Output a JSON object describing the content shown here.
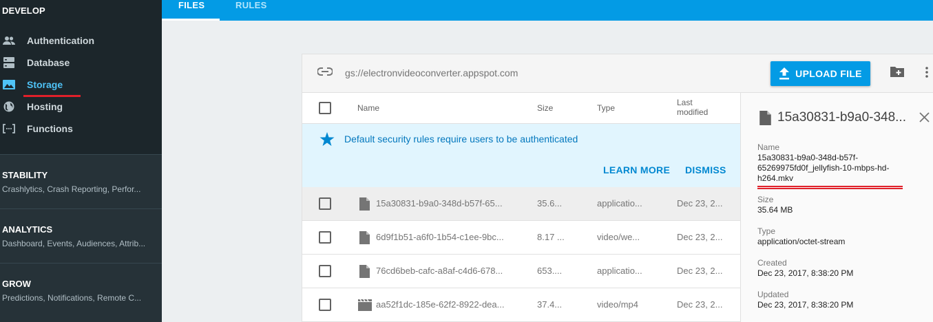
{
  "sidebar": {
    "develop_title": "DEVELOP",
    "items": [
      {
        "label": "Authentication",
        "icon": "people-icon"
      },
      {
        "label": "Database",
        "icon": "database-icon"
      },
      {
        "label": "Storage",
        "icon": "photo-icon"
      },
      {
        "label": "Hosting",
        "icon": "globe-icon"
      },
      {
        "label": "Functions",
        "icon": "functions-icon"
      }
    ],
    "groups": [
      {
        "title": "STABILITY",
        "subtitle": "Crashlytics, Crash Reporting, Perfor..."
      },
      {
        "title": "ANALYTICS",
        "subtitle": "Dashboard, Events, Audiences, Attrib..."
      },
      {
        "title": "GROW",
        "subtitle": "Predictions, Notifications, Remote C..."
      }
    ]
  },
  "tabs": {
    "files": "FILES",
    "rules": "RULES"
  },
  "toolbar": {
    "bucket_path": "gs://electronvideoconverter.appspot.com",
    "upload_label": "UPLOAD FILE"
  },
  "table": {
    "headers": {
      "name": "Name",
      "size": "Size",
      "type": "Type",
      "modified_1": "Last",
      "modified_2": "modified"
    },
    "rows": [
      {
        "name": "15a30831-b9a0-348d-b57f-65...",
        "size": "35.6...",
        "type": "applicatio...",
        "modified": "Dec 23, 2...",
        "icon": "file-icon"
      },
      {
        "name": "6d9f1b51-a6f0-1b54-c1ee-9bc...",
        "size": "8.17 ...",
        "type": "video/we...",
        "modified": "Dec 23, 2...",
        "icon": "file-icon"
      },
      {
        "name": "76cd6beb-cafc-a8af-c4d6-678...",
        "size": "653....",
        "type": "applicatio...",
        "modified": "Dec 23, 2...",
        "icon": "file-icon"
      },
      {
        "name": "aa52f1dc-185e-62f2-8922-dea...",
        "size": "37.4...",
        "type": "video/mp4",
        "modified": "Dec 23, 2...",
        "icon": "movie-icon"
      }
    ]
  },
  "banner": {
    "message": "Default security rules require users to be authenticated",
    "learn_more": "LEARN MORE",
    "dismiss": "DISMISS"
  },
  "details": {
    "title": "15a30831-b9a0-348...",
    "name_label": "Name",
    "name_value": "15a30831-b9a0-348d-b57f-65269975fd0f_jellyfish-10-mbps-hd-h264.mkv",
    "size_label": "Size",
    "size_value": "35.64 MB",
    "type_label": "Type",
    "type_value": "application/octet-stream",
    "created_label": "Created",
    "created_value": "Dec 23, 2017, 8:38:20 PM",
    "updated_label": "Updated",
    "updated_value": "Dec 23, 2017, 8:38:20 PM"
  },
  "colors": {
    "accent": "#039be5",
    "sidebar": "#263238",
    "highlight": "#e0202a"
  }
}
